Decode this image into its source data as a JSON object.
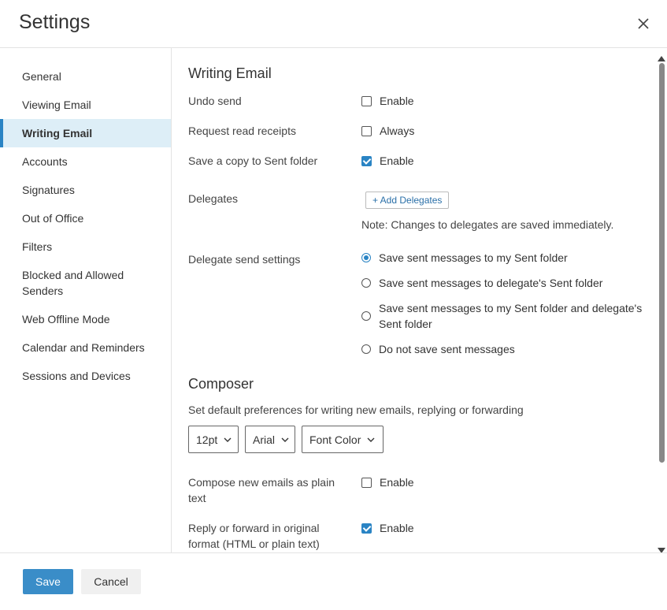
{
  "header": {
    "title": "Settings",
    "close_icon": "close-icon"
  },
  "sidebar": {
    "items": [
      {
        "label": "General"
      },
      {
        "label": "Viewing Email"
      },
      {
        "label": "Writing Email",
        "active": true
      },
      {
        "label": "Accounts"
      },
      {
        "label": "Signatures"
      },
      {
        "label": "Out of Office"
      },
      {
        "label": "Filters"
      },
      {
        "label": "Blocked and Allowed Senders"
      },
      {
        "label": "Web Offline Mode"
      },
      {
        "label": "Calendar and Reminders"
      },
      {
        "label": "Sessions and Devices"
      }
    ]
  },
  "writing": {
    "title": "Writing Email",
    "undo_send": {
      "label": "Undo send",
      "option": "Enable",
      "checked": false
    },
    "read_receipts": {
      "label": "Request read receipts",
      "option": "Always",
      "checked": false
    },
    "save_copy": {
      "label": "Save a copy to Sent folder",
      "option": "Enable",
      "checked": true
    },
    "delegates": {
      "label": "Delegates",
      "add_button": "+ Add Delegates",
      "note": "Note: Changes to delegates are saved immediately."
    },
    "delegate_send": {
      "label": "Delegate send settings",
      "options": [
        {
          "label": "Save sent messages to my Sent folder",
          "checked": true
        },
        {
          "label": "Save sent messages to delegate's Sent folder",
          "checked": false
        },
        {
          "label": "Save sent messages to my Sent folder and delegate's Sent folder",
          "checked": false
        },
        {
          "label": "Do not save sent messages",
          "checked": false
        }
      ]
    }
  },
  "composer": {
    "title": "Composer",
    "description": "Set default preferences for writing new emails, replying or forwarding",
    "font_size": "12pt",
    "font_family": "Arial",
    "font_color": "Font Color",
    "plain_text": {
      "label": "Compose new emails as plain text",
      "option": "Enable",
      "checked": false
    },
    "original_format": {
      "label": "Reply or forward in original format (HTML or plain text)",
      "option": "Enable",
      "checked": true
    }
  },
  "footer": {
    "save_label": "Save",
    "cancel_label": "Cancel"
  },
  "colors": {
    "accent": "#2a84c4",
    "save_button": "#3a8dc8",
    "active_nav_bg": "#ddeef7"
  }
}
